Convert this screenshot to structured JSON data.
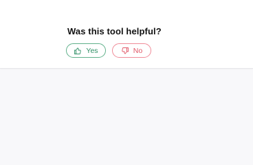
{
  "feedback": {
    "question": "Was this tool helpful?",
    "yes": {
      "label": "Yes",
      "icon": "thumbs-up-icon",
      "color": "#2f8f66",
      "border_color": "#5fb08a"
    },
    "no": {
      "label": "No",
      "icon": "thumbs-down-icon",
      "color": "#e05565",
      "border_color": "#f08b98"
    }
  },
  "colors": {
    "page_background": "#f8f8fa",
    "panel_background": "#ffffff",
    "divider": "#e6e6ea",
    "text": "#111111"
  }
}
